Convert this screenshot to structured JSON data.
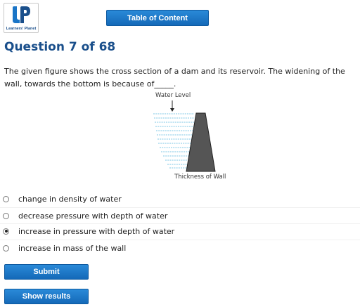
{
  "header": {
    "logo_text": "Learners' Planet",
    "toc_label": "Table of Content"
  },
  "question": {
    "title": "Question 7 of 68",
    "text": "The given figure shows the cross section of a dam and its reservoir. The widening of the wall, towards the bottom is because of_____.",
    "figure": {
      "top_label": "Water Level",
      "bottom_label": "Thickness of Wall"
    }
  },
  "options": [
    {
      "label": "change in density of water",
      "selected": false
    },
    {
      "label": "decrease pressure with depth of water",
      "selected": false
    },
    {
      "label": "increase in pressure with depth of water",
      "selected": true
    },
    {
      "label": "increase in mass of the wall",
      "selected": false
    }
  ],
  "actions": {
    "submit_label": "Submit",
    "results_label": "Show results"
  },
  "colors": {
    "accent": "#1a4f8b",
    "button": "#1a75c7",
    "water_lines": "#7cc7e6"
  }
}
